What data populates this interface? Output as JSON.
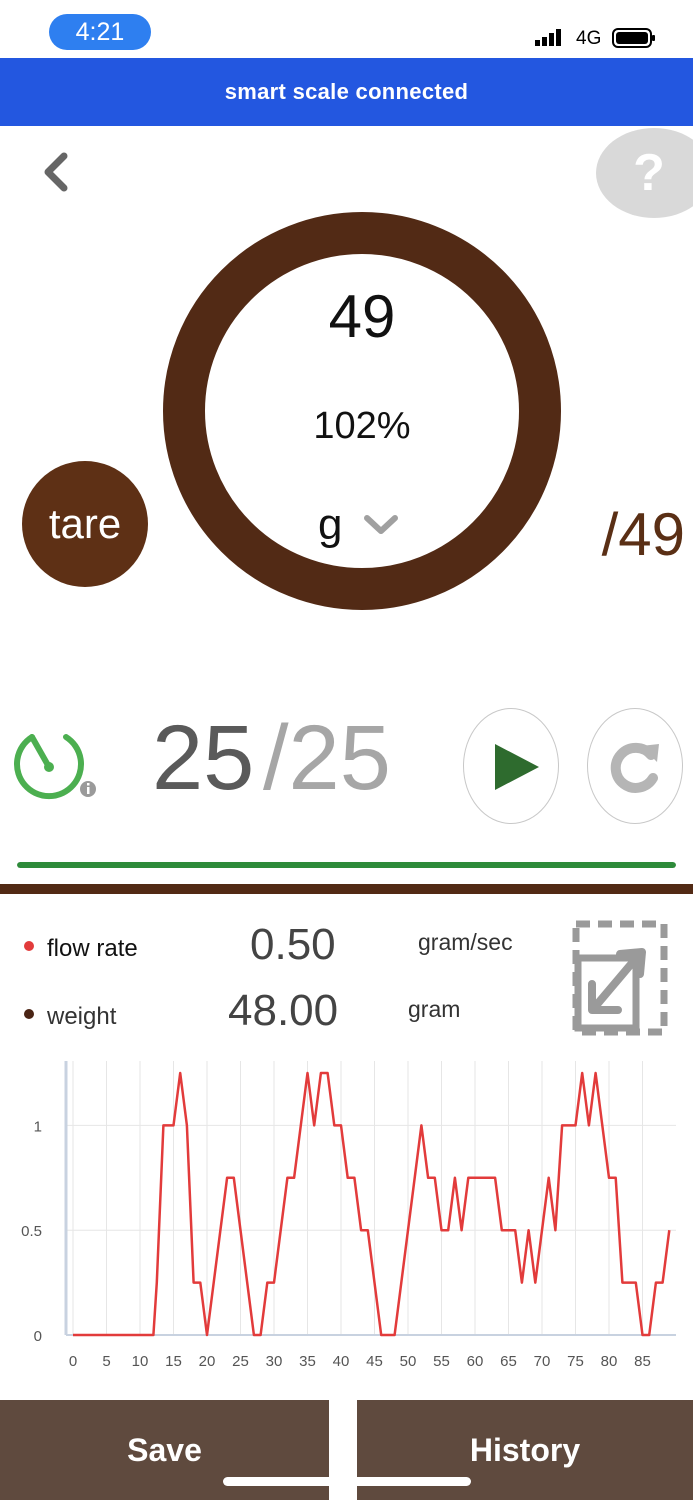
{
  "status_bar": {
    "time": "4:21",
    "network": "4G",
    "icons": [
      "signal-icon",
      "battery-icon"
    ]
  },
  "banner": {
    "text": "smart scale connected"
  },
  "nav": {
    "back_icon": "chevron-left-icon",
    "help_icon": "question-icon"
  },
  "scale": {
    "weight": "49",
    "percent": "102%",
    "unit": "g",
    "unit_icon": "chevron-down-icon",
    "target": "/49",
    "tare_label": "tare"
  },
  "timer": {
    "elapsed": "25",
    "target": "/25",
    "icon": "stopwatch-icon",
    "info_icon": "info-icon",
    "play_icon": "play-icon",
    "reset_icon": "reset-icon",
    "progress": 1.0
  },
  "readings": {
    "flow_label": "flow rate",
    "flow_value": "0.50",
    "flow_unit": "gram/sec",
    "weight_label": "weight",
    "weight_value": "48.00",
    "weight_unit": "gram",
    "export_icon": "export-icon"
  },
  "colors": {
    "banner": "#2357e0",
    "brown": "#522a15",
    "flow_line": "#e23b3b",
    "play_green": "#2e6b2e",
    "progress_green": "#2e8b3a",
    "button_bg": "#5f4a3e"
  },
  "chart_data": {
    "type": "line",
    "xlabel": "",
    "ylabel": "",
    "x_ticks": [
      "0",
      "5",
      "10",
      "15",
      "20",
      "25",
      "30",
      "35",
      "40",
      "45",
      "50",
      "55",
      "60",
      "65",
      "70",
      "75",
      "80",
      "85"
    ],
    "y_ticks": [
      "0",
      "0.5",
      "1"
    ],
    "xlim": [
      0,
      90
    ],
    "ylim": [
      0,
      1.25
    ],
    "grid": true,
    "series": [
      {
        "x": [
          0,
          12,
          12.5,
          13.5,
          14,
          15,
          16,
          17,
          18,
          19,
          20,
          21,
          22,
          23,
          24,
          25,
          26,
          27,
          28,
          29,
          30,
          31,
          32,
          33,
          34,
          35,
          36,
          37,
          38,
          39,
          40,
          41,
          42,
          43,
          44,
          45,
          46,
          47,
          48,
          49,
          50,
          51,
          52,
          53,
          54,
          55,
          56,
          57,
          58,
          59,
          60,
          61,
          62,
          63,
          64,
          65,
          66,
          67,
          68,
          69,
          70,
          71,
          72,
          73,
          74,
          75,
          76,
          77,
          78,
          79,
          80,
          81,
          82,
          83,
          84,
          85,
          86,
          87,
          88,
          89
        ],
        "values": [
          0,
          0,
          0.25,
          1,
          1,
          1,
          1.25,
          1,
          0.25,
          0.25,
          0,
          0.25,
          0.5,
          0.75,
          0.75,
          0.5,
          0.25,
          0,
          0,
          0.25,
          0.25,
          0.5,
          0.75,
          0.75,
          1,
          1.25,
          1,
          1.25,
          1.25,
          1,
          1,
          0.75,
          0.75,
          0.5,
          0.5,
          0.25,
          0,
          0,
          0,
          0.25,
          0.5,
          0.75,
          1,
          0.75,
          0.75,
          0.5,
          0.5,
          0.75,
          0.5,
          0.75,
          0.75,
          0.75,
          0.75,
          0.75,
          0.5,
          0.5,
          0.5,
          0.25,
          0.5,
          0.25,
          0.5,
          0.75,
          0.5,
          1,
          1,
          1,
          1.25,
          1,
          1.25,
          1,
          0.75,
          0.75,
          0.25,
          0.25,
          0.25,
          0,
          0,
          0.25,
          0.25,
          0.5
        ]
      }
    ]
  },
  "actions": {
    "save_label": "Save",
    "history_label": "History"
  }
}
